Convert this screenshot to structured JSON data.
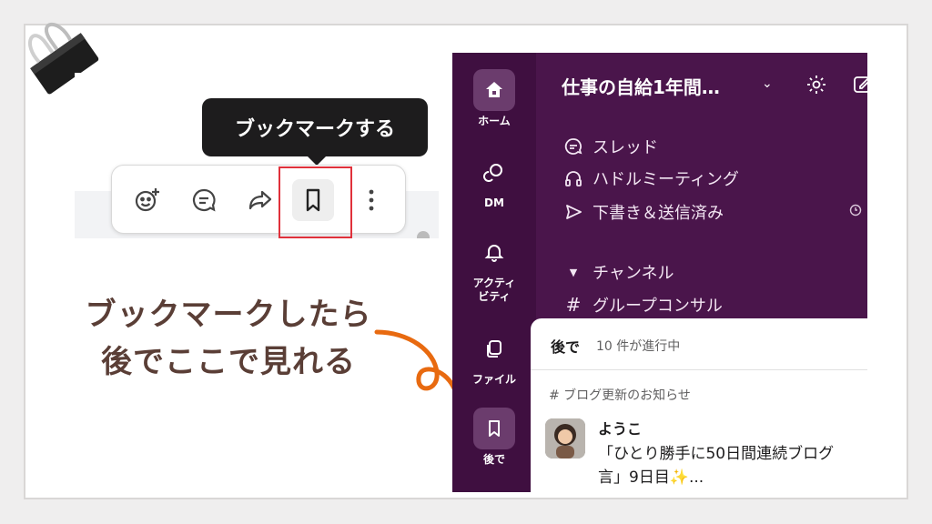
{
  "tooltip": {
    "text": "ブックマークする"
  },
  "toolbar": {
    "buttons": [
      {
        "name": "add-reaction-icon"
      },
      {
        "name": "reply-thread-icon"
      },
      {
        "name": "share-forward-icon"
      },
      {
        "name": "bookmark-icon"
      },
      {
        "name": "more-vertical-icon"
      }
    ]
  },
  "annotation": {
    "line1": "ブックマークしたら",
    "line2": "後でここで見れる"
  },
  "colors": {
    "accent": "#e86a10",
    "highlight_box": "#e0313b",
    "text": "#5a3e36",
    "slack_bg": "#4a154b",
    "slack_rail": "#3f0f40"
  },
  "slack": {
    "rail": [
      {
        "label": "ホーム",
        "icon": "home-icon"
      },
      {
        "label": "DM",
        "icon": "dm-icon"
      },
      {
        "label": "アクティビティ",
        "icon": "bell-icon"
      },
      {
        "label": "ファイル",
        "icon": "files-icon"
      },
      {
        "label": "後で",
        "icon": "bookmark-icon"
      }
    ],
    "workspace": {
      "title": "仕事の自給1年間…"
    },
    "nav": [
      {
        "label": "スレッド",
        "icon": "threads-icon"
      },
      {
        "label": "ハドルミーティング",
        "icon": "headphones-icon"
      },
      {
        "label": "下書き＆送信済み",
        "icon": "send-icon"
      }
    ],
    "channels_header": "チャンネル",
    "channel": "グループコンサル",
    "later": {
      "title": "後で",
      "count": "10 件が進行中",
      "channel": "# ブログ更新のお知らせ",
      "author": "ようこ",
      "message_line1": "「ひとり勝手に50日間連続ブログ",
      "message_line2": "言」9日目✨..."
    }
  }
}
